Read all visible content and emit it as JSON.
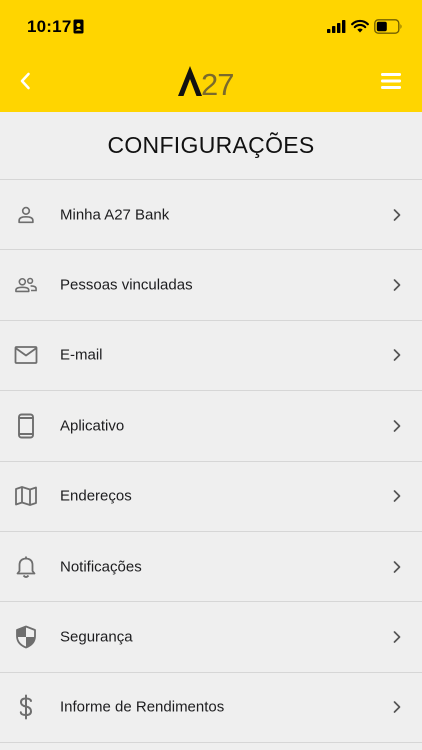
{
  "status_bar": {
    "time": "10:17"
  },
  "header": {
    "logo_text": "A27"
  },
  "page": {
    "title": "CONFIGURAÇÕES"
  },
  "colors": {
    "brand_yellow": "#ffd500",
    "background": "#efefef",
    "icon_gray": "#6e6e6e"
  },
  "menu": [
    {
      "label": "Minha A27 Bank",
      "icon": "person-icon"
    },
    {
      "label": "Pessoas vinculadas",
      "icon": "people-icon"
    },
    {
      "label": "E-mail",
      "icon": "mail-icon"
    },
    {
      "label": "Aplicativo",
      "icon": "smartphone-icon"
    },
    {
      "label": "Endereços",
      "icon": "map-icon"
    },
    {
      "label": "Notificações",
      "icon": "bell-icon"
    },
    {
      "label": "Segurança",
      "icon": "shield-icon"
    },
    {
      "label": "Informe de Rendimentos",
      "icon": "dollar-icon"
    }
  ]
}
